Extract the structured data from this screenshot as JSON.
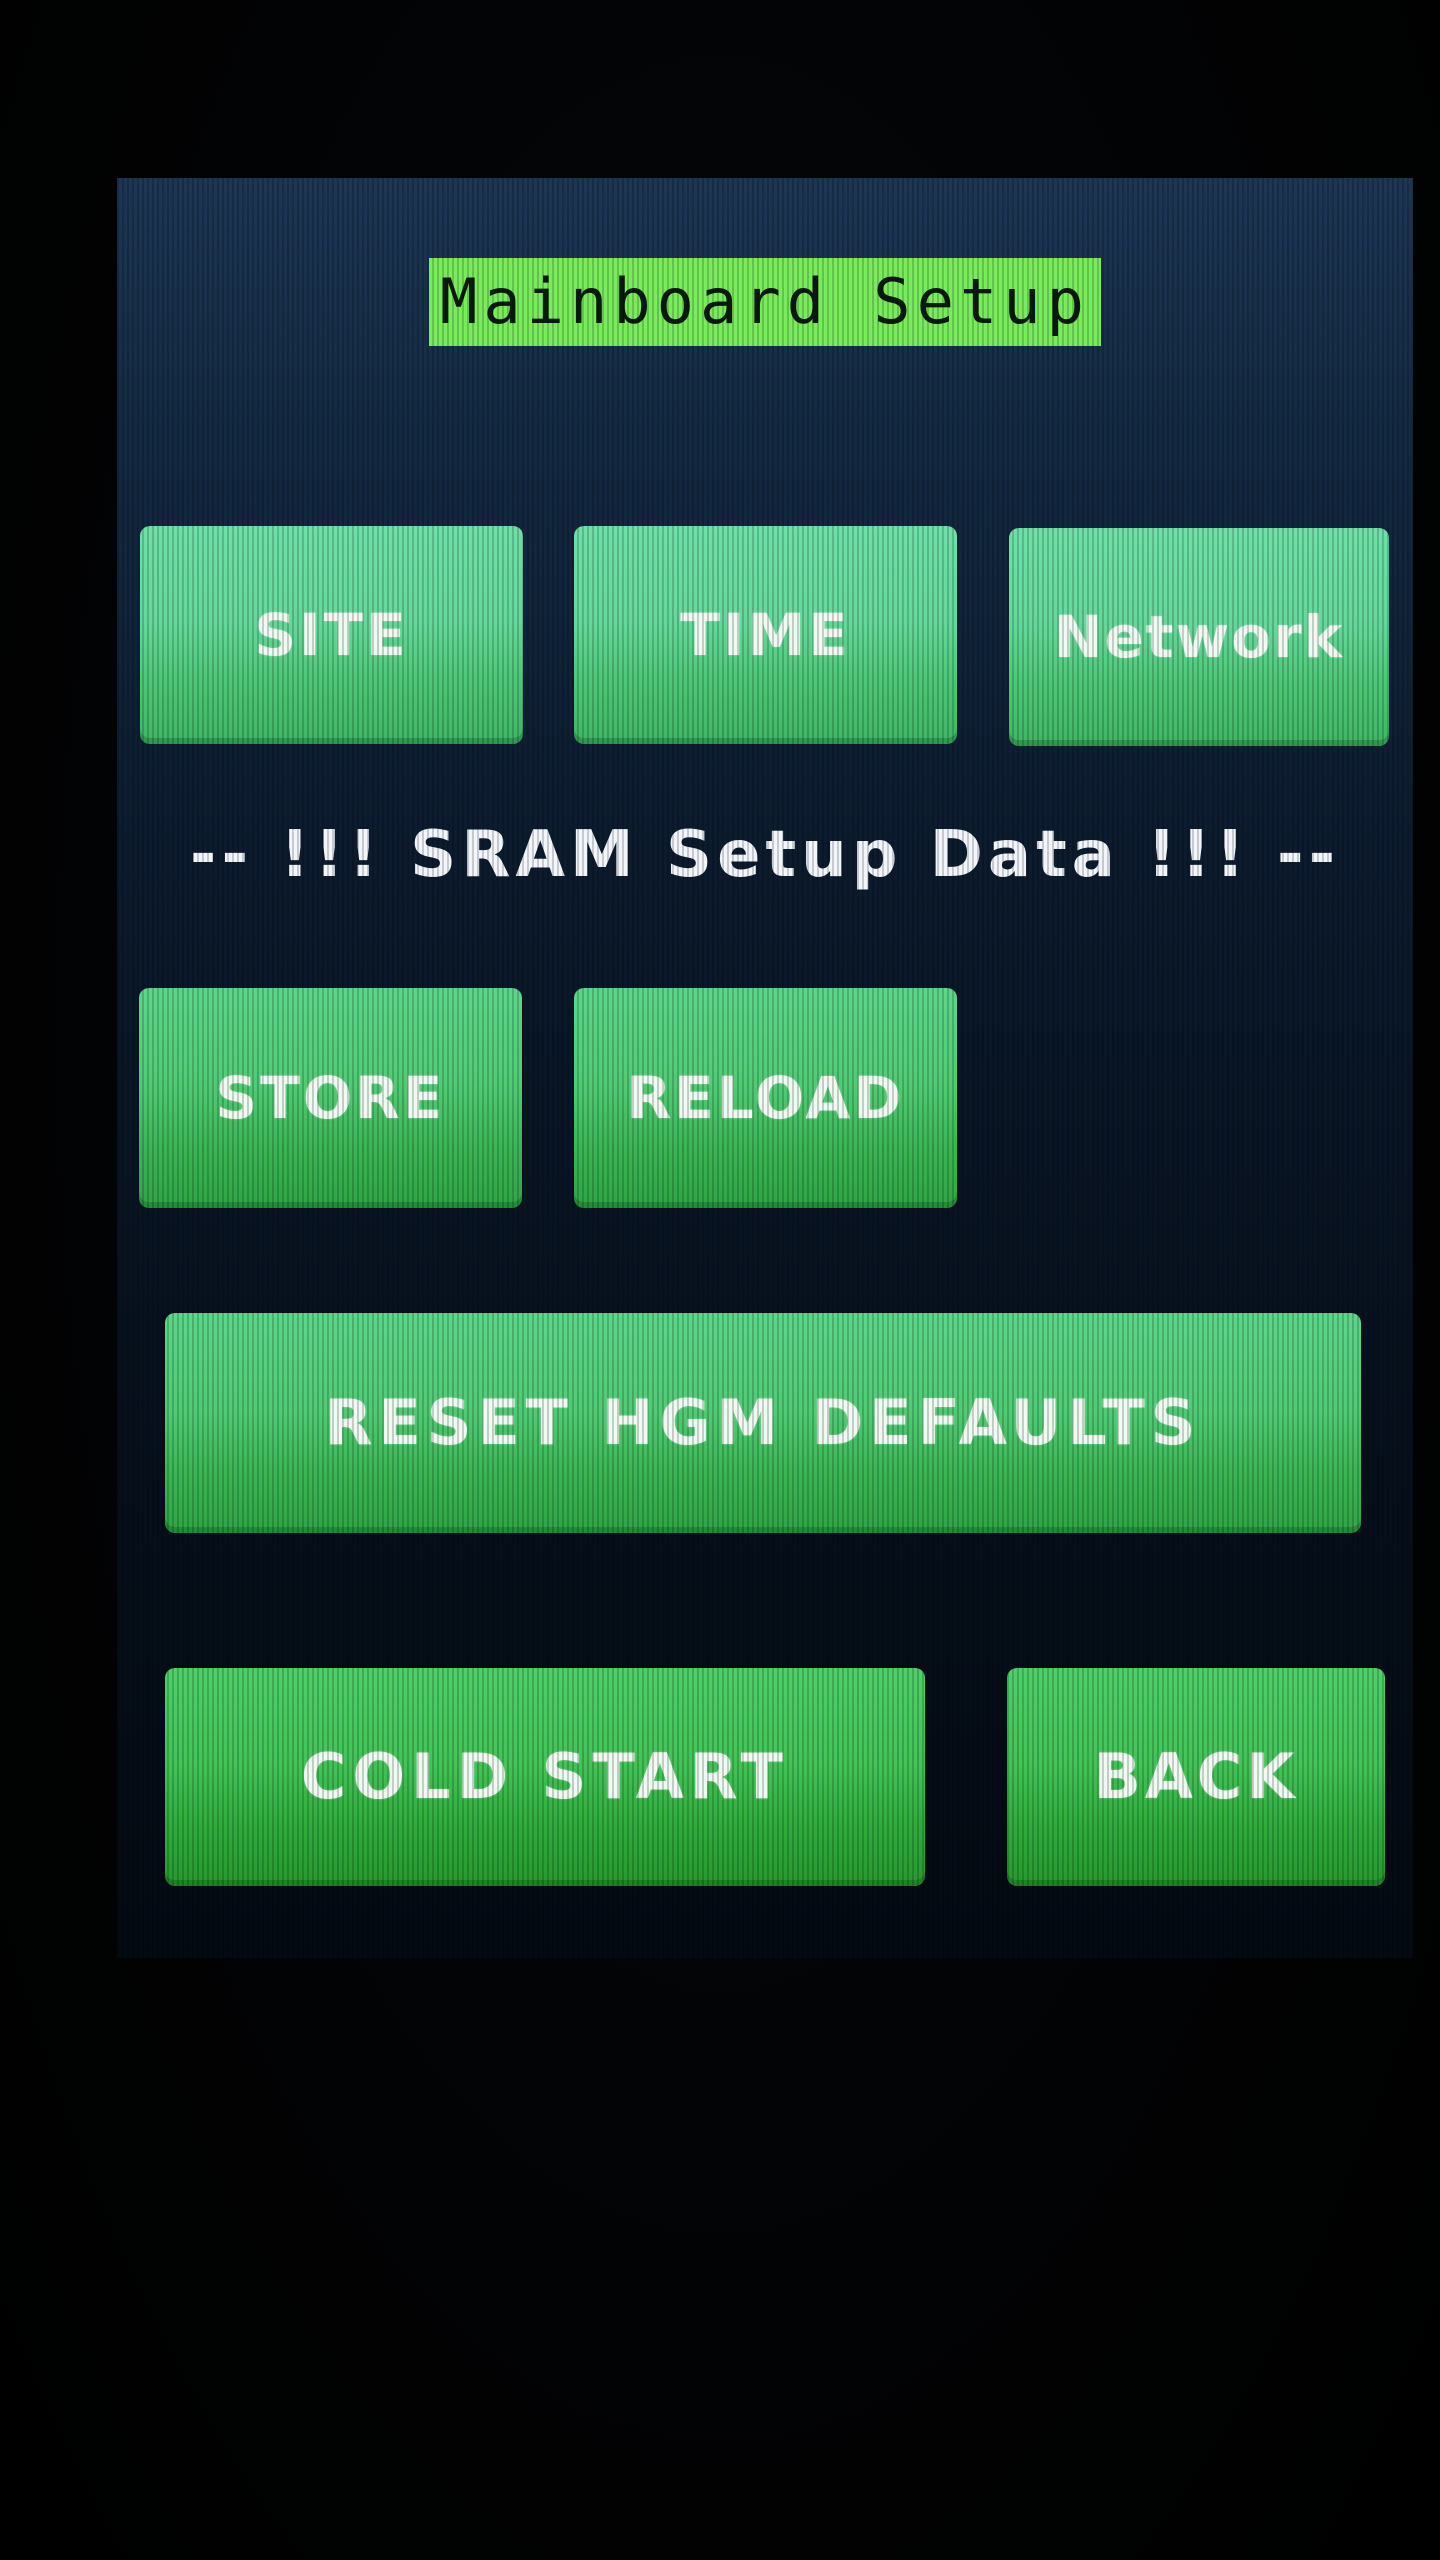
{
  "screen": {
    "title": "Mainboard Setup",
    "top_buttons": {
      "site": "SITE",
      "time": "TIME",
      "network": "Network"
    },
    "sram_separator": "-- !!! SRAM Setup Data !!! --",
    "sram_buttons": {
      "store": "STORE",
      "reload": "RELOAD"
    },
    "reset_button": "RESET HGM DEFAULTS",
    "bottom_buttons": {
      "cold_start": "COLD START",
      "back": "BACK"
    }
  },
  "colors": {
    "title_background": "#78ec5a",
    "screen_background": "#0c1b2e",
    "button_green": "#4fcb74",
    "text_white": "#eefaf2"
  }
}
